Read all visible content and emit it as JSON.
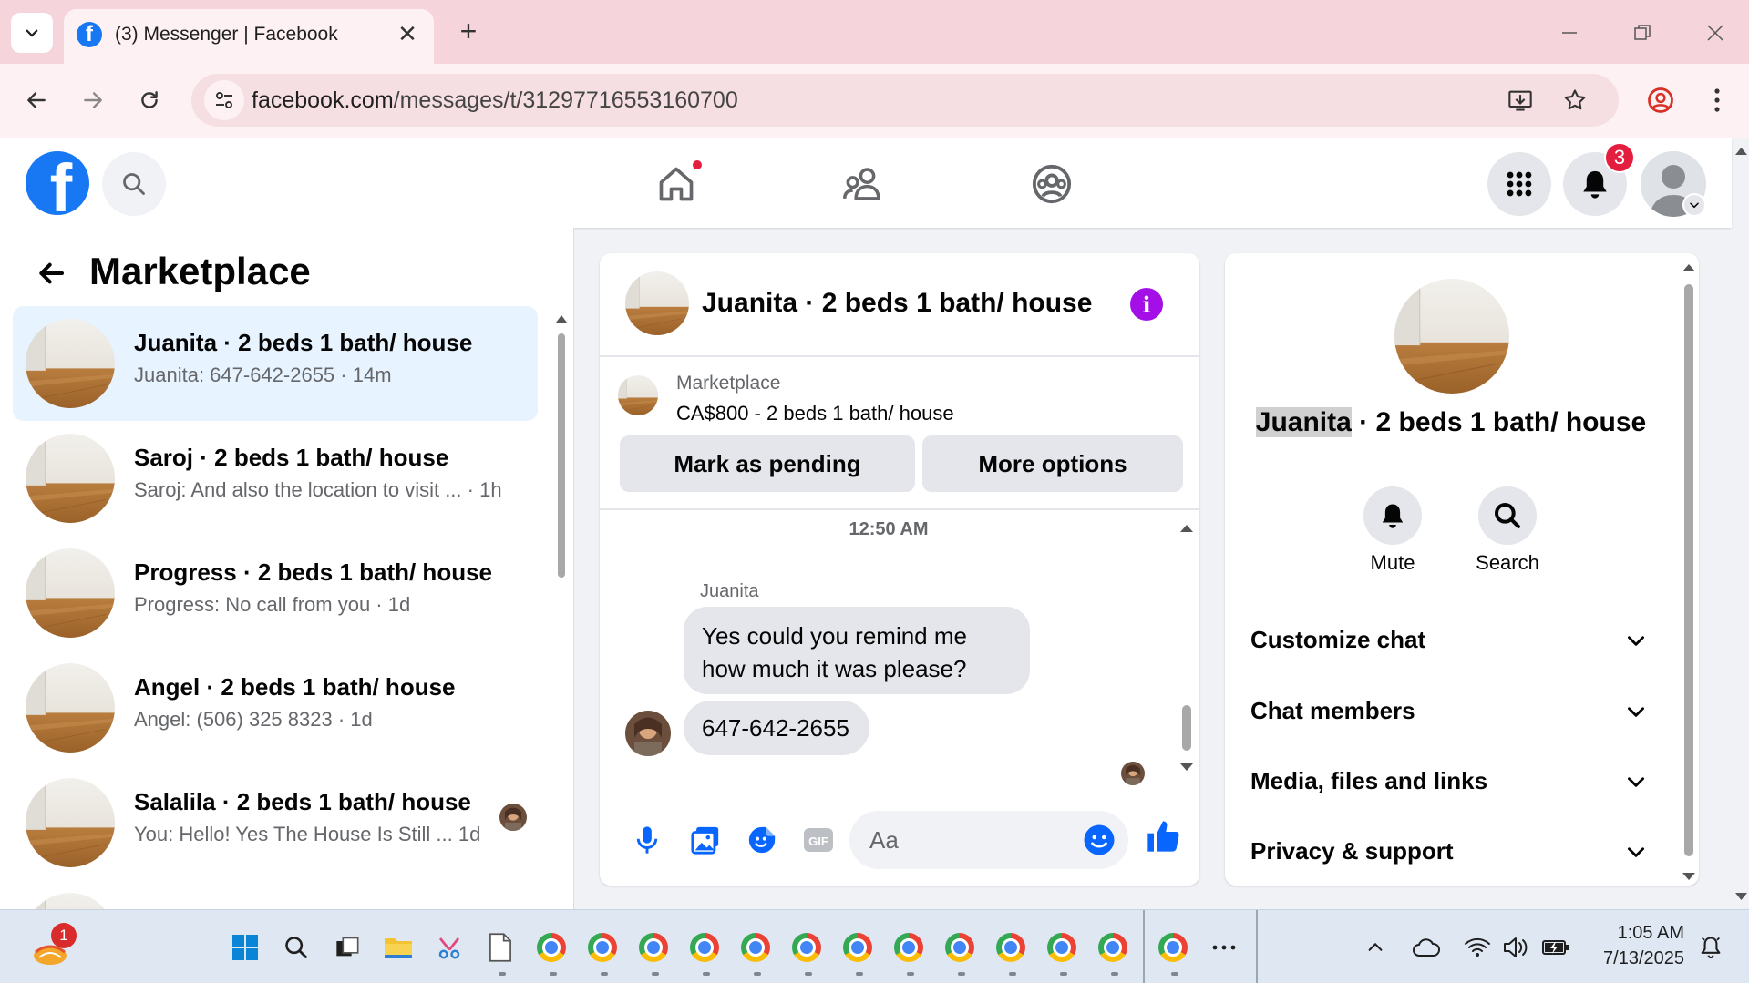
{
  "browser": {
    "tab_title": "(3) Messenger | Facebook",
    "url_host": "facebook.com",
    "url_path": "/messages/t/31297716553160700"
  },
  "header": {
    "notification_count": "3"
  },
  "marketplace": {
    "title": "Marketplace",
    "conversations": [
      {
        "title": "Juanita · 2 beds 1 bath/ house",
        "subtitle": "Juanita: 647-642-2655 · 14m",
        "selected": true
      },
      {
        "title": "Saroj · 2 beds 1 bath/ house",
        "subtitle": "Saroj: And also the location to visit ... · 1h",
        "selected": false
      },
      {
        "title": "Progress · 2 beds 1 bath/ house",
        "subtitle": "Progress: No call from you · 1d",
        "selected": false
      },
      {
        "title": "Angel · 2 beds 1 bath/ house",
        "subtitle": "Angel: (506) 325 8323 · 1d",
        "selected": false
      },
      {
        "title": "Salalila · 2 beds 1 bath/ house",
        "subtitle": "You: Hello! Yes The House Is Still ...  1d",
        "selected": false
      }
    ]
  },
  "chat": {
    "title": "Juanita · 2 beds 1 bath/ house",
    "listing_label": "Marketplace",
    "listing_price": "CA$800 - 2 beds 1 bath/ house",
    "mark_pending_label": "Mark as pending",
    "more_options_label": "More options",
    "timestamp": "12:50 AM",
    "sender_name": "Juanita",
    "messages": [
      "Yes could you remind me how much it was please?",
      "647-642-2655"
    ],
    "input_placeholder": "Aa"
  },
  "details": {
    "name_highlight": "Juanita",
    "name_rest": " · 2 beds 1 bath/ house",
    "mute_label": "Mute",
    "search_label": "Search",
    "sections": [
      "Customize chat",
      "Chat members",
      "Media, files and links",
      "Privacy & support"
    ]
  },
  "taskbar": {
    "widget_badge": "1",
    "time": "1:05 AM",
    "date": "7/13/2025"
  },
  "colors": {
    "facebook_blue": "#1877f2",
    "messenger_purple": "#a30fe6",
    "notification_red": "#e41e3f",
    "selected_row": "#e7f3ff",
    "titlebar_pink": "#f5d5db"
  }
}
